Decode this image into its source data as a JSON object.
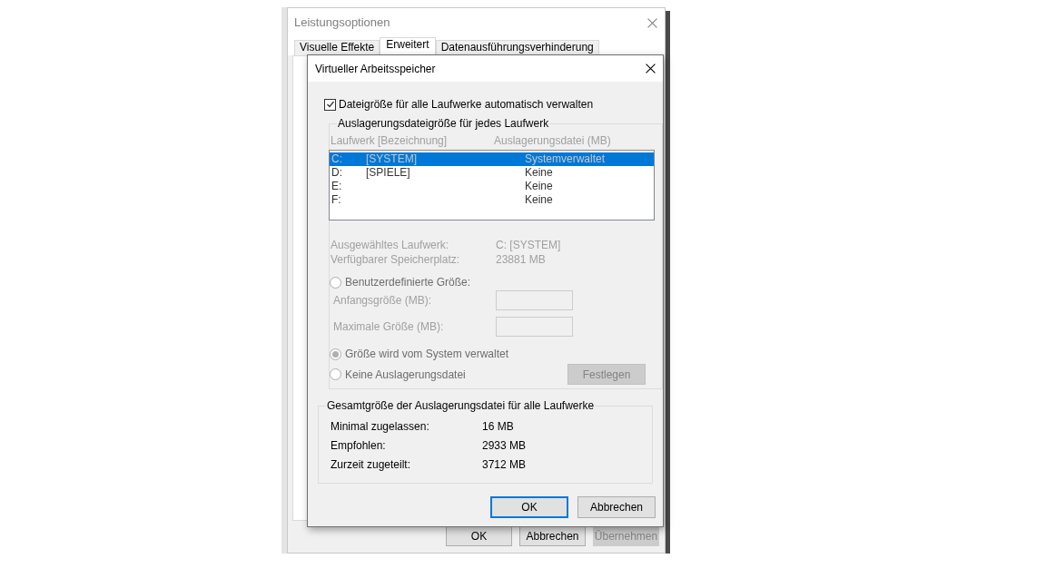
{
  "background_window": {
    "title": "Leistungsoptionen",
    "tabs": [
      {
        "label": "Visuelle Effekte",
        "selected": false
      },
      {
        "label": "Erweitert",
        "selected": true
      },
      {
        "label": "Datenausführungsverhinderung",
        "selected": false
      }
    ],
    "buttons": [
      {
        "label": "OK",
        "disabled": false
      },
      {
        "label": "Abbrechen",
        "disabled": false
      },
      {
        "label": "Übernehmen",
        "disabled": true
      }
    ]
  },
  "dialog": {
    "title": "Virtueller Arbeitsspeicher",
    "auto_manage": {
      "label": "Dateigröße für alle Laufwerke automatisch verwalten",
      "checked": true
    },
    "drive_group": {
      "legend": "Auslagerungsdateigröße für jedes Laufwerk",
      "disabled": true,
      "columns": [
        "Laufwerk [Bezeichnung]",
        "Auslagerungsdatei (MB)"
      ],
      "drives": [
        {
          "letter": "C:",
          "label": "[SYSTEM]",
          "paging_file": "Systemverwaltet",
          "selected": true
        },
        {
          "letter": "D:",
          "label": "[SPIELE]",
          "paging_file": "Keine",
          "selected": false
        },
        {
          "letter": "E:",
          "paging_file": "Keine",
          "selected": false
        },
        {
          "letter": "F:",
          "paging_file": "Keine",
          "selected": false
        }
      ],
      "info": [
        {
          "label": "Ausgewähltes Laufwerk:",
          "value": "C:  [SYSTEM]"
        },
        {
          "label": "Verfügbarer Speicherplatz:",
          "value": "23881 MB"
        }
      ],
      "options": [
        {
          "label": "Benutzerdefinierte Größe:",
          "selected": false
        },
        {
          "label": "Größe wird vom System verwaltet",
          "selected": true
        },
        {
          "label": "Keine Auslagerungsdatei",
          "selected": false
        }
      ],
      "size_fields": [
        {
          "label": "Anfangsgröße (MB):"
        },
        {
          "label": "Maximale Größe (MB):"
        }
      ],
      "set_button": {
        "label": "Festlegen"
      }
    },
    "total_group": {
      "legend": "Gesamtgröße der Auslagerungsdatei für alle Laufwerke",
      "rows": [
        {
          "label": "Minimal zugelassen:",
          "value": "16 MB"
        },
        {
          "label": "Empfohlen:",
          "value": "2933 MB"
        },
        {
          "label": "Zurzeit zugeteilt:",
          "value": "3712 MB"
        }
      ]
    },
    "buttons": [
      {
        "label": "OK",
        "default": true
      },
      {
        "label": "Abbrechen",
        "default": false
      }
    ]
  }
}
